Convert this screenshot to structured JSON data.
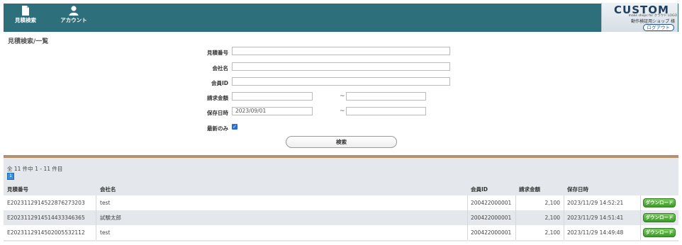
{
  "header": {
    "nav": [
      {
        "label": "見積検索",
        "icon": "document-icon"
      },
      {
        "label": "アカウント",
        "icon": "user-icon"
      }
    ],
    "brand": {
      "logo": "CUSTOM",
      "tagline": "make shops for クラウド LOGO",
      "shop_name": "動作検証用ショップ 様",
      "logout_label": "ログアウト"
    },
    "bar_color": "#2e6f7c"
  },
  "search": {
    "title": "見積検索/一覧",
    "fields": {
      "quote_no_label": "見積番号",
      "company_label": "会社名",
      "member_id_label": "会員ID",
      "amount_label": "請求金額",
      "date_label": "保存日時",
      "date_from_value": "2023/09/01",
      "latest_only_label": "最新のみ",
      "latest_only_checked": true,
      "range_separator": "~"
    },
    "button_label": "検索"
  },
  "results": {
    "count_text": "全 11 件中 1 - 11 件目",
    "current_page": "1",
    "headers": {
      "quote_no": "見積番号",
      "company": "会社名",
      "member_id": "会員ID",
      "amount": "請求金額",
      "saved_at": "保存日時"
    },
    "download_label": "ダウンロード",
    "rows": [
      {
        "quote_no": "E2023112914522876273203",
        "company": "test",
        "member_id": "200422000001",
        "amount": "2,100",
        "saved_at": "2023/11/29 14:52:21"
      },
      {
        "quote_no": "E2023112914514433346365",
        "company": "試験太郎",
        "member_id": "200422000001",
        "amount": "2,100",
        "saved_at": "2023/11/29 14:51:41"
      },
      {
        "quote_no": "E2023112914502005532112",
        "company": "test",
        "member_id": "200422000001",
        "amount": "2,100",
        "saved_at": "2023/11/29 14:49:48"
      }
    ]
  }
}
